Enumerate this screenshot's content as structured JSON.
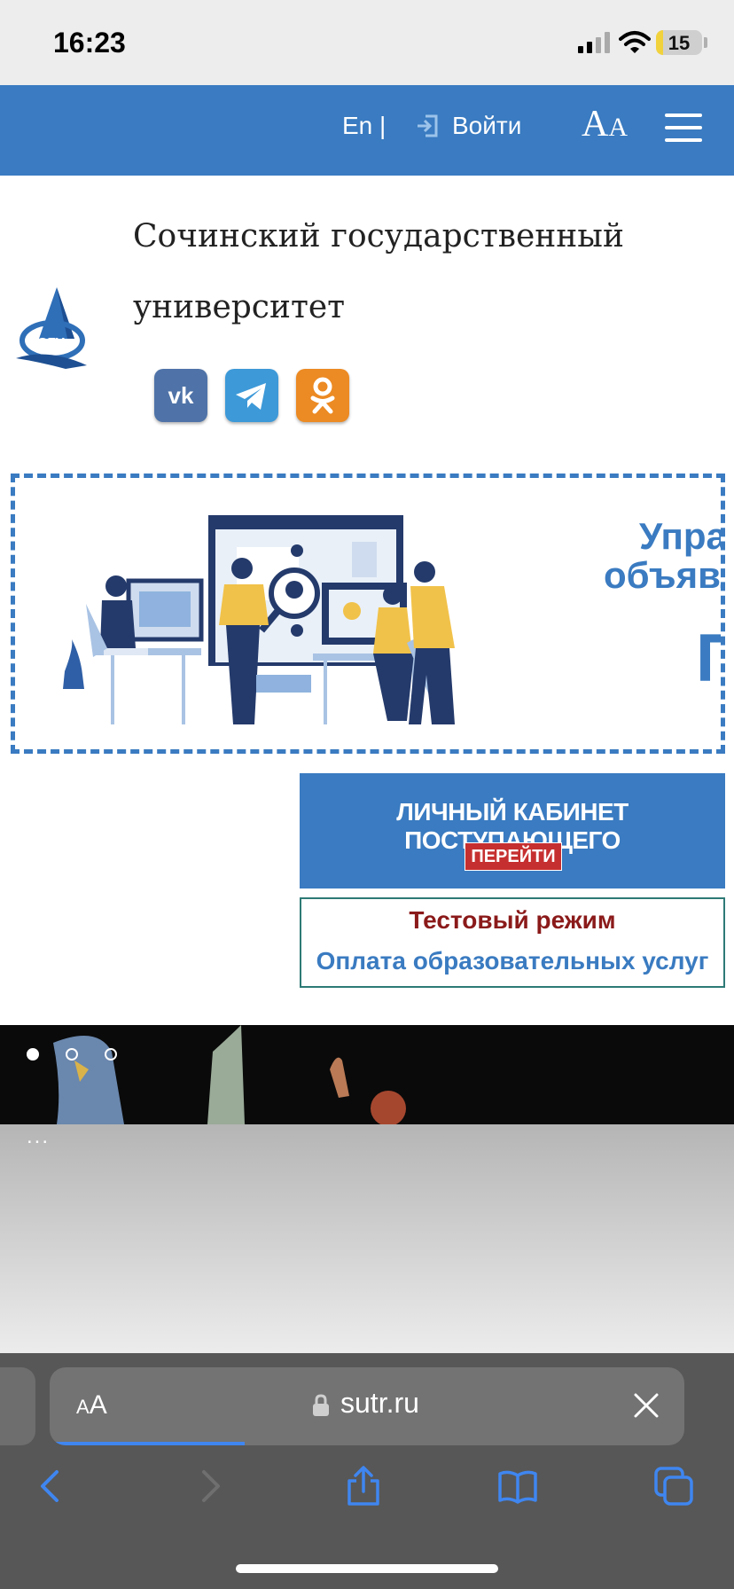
{
  "status_bar": {
    "time": "16:23",
    "battery": "15"
  },
  "header": {
    "lang": "En |",
    "login": "Войти",
    "font_button_big": "A",
    "font_button_small": "A"
  },
  "university": {
    "name_line1": "Сочинский государственный",
    "name_line2": "университет"
  },
  "banner": {
    "text_line1": "Управ",
    "text_line2": "объявл",
    "text_line3": "П"
  },
  "cabinet": {
    "title": "ЛИЧНЫЙ КАБИНЕТ ПОСТУПАЮЩЕГО",
    "button": "ПЕРЕЙТИ"
  },
  "payment": {
    "mode": "Тестовый режим",
    "link": "Оплата образовательных услуг"
  },
  "slider": {
    "more": "..."
  },
  "browser": {
    "aa_small": "A",
    "aa_big": "A",
    "url": "sutr.ru"
  },
  "icons": {
    "login": "login-icon",
    "menu": "hamburger-menu-icon",
    "vk": "vk-icon",
    "telegram": "telegram-icon",
    "odnoklassniki": "ok-icon",
    "lock": "lock-icon",
    "close": "close-icon",
    "back": "chevron-left-icon",
    "forward": "chevron-right-icon",
    "share": "share-icon",
    "bookmarks": "book-icon",
    "tabs": "tabs-icon"
  },
  "colors": {
    "brand_blue": "#3a7bc1",
    "accent_red": "#c62f2f",
    "dark_red": "#8b1a1a"
  }
}
